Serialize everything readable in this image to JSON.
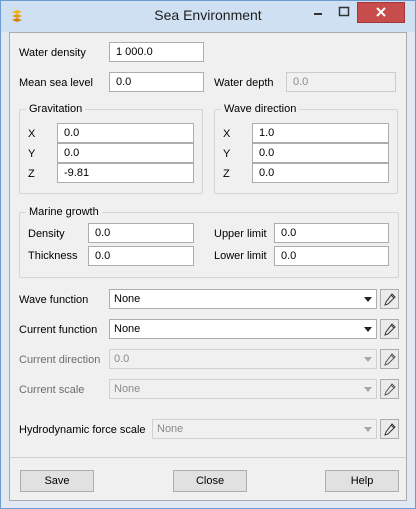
{
  "window": {
    "title": "Sea Environment"
  },
  "fields": {
    "water_density": {
      "label": "Water density",
      "value": "1 000.0"
    },
    "mean_sea_level": {
      "label": "Mean sea level",
      "value": "0.0"
    },
    "water_depth": {
      "label": "Water depth",
      "value": "0.0"
    }
  },
  "gravitation": {
    "title": "Gravitation",
    "x_label": "X",
    "x": "0.0",
    "y_label": "Y",
    "y": "0.0",
    "z_label": "Z",
    "z": "-9.81"
  },
  "wave_direction": {
    "title": "Wave direction",
    "x_label": "X",
    "x": "1.0",
    "y_label": "Y",
    "y": "0.0",
    "z_label": "Z",
    "z": "0.0"
  },
  "marine_growth": {
    "title": "Marine growth",
    "density_label": "Density",
    "density": "0.0",
    "thickness_label": "Thickness",
    "thickness": "0.0",
    "upper_label": "Upper limit",
    "upper": "0.0",
    "lower_label": "Lower limit",
    "lower": "0.0"
  },
  "functions": {
    "wave_label": "Wave function",
    "wave_value": "None",
    "current_label": "Current function",
    "current_value": "None",
    "current_dir_label": "Current direction",
    "current_dir_value": "0.0",
    "current_scale_label": "Current scale",
    "current_scale_value": "None",
    "hydro_label": "Hydrodynamic force scale",
    "hydro_value": "None"
  },
  "buttons": {
    "save": "Save",
    "close": "Close",
    "help": "Help"
  },
  "icons": {
    "app": "app-icon",
    "edit": "pencil-icon"
  },
  "colors": {
    "title_bar": "#cfe0f3",
    "close_button": "#c74c4c",
    "dialog_bg": "#f0f0f0"
  }
}
